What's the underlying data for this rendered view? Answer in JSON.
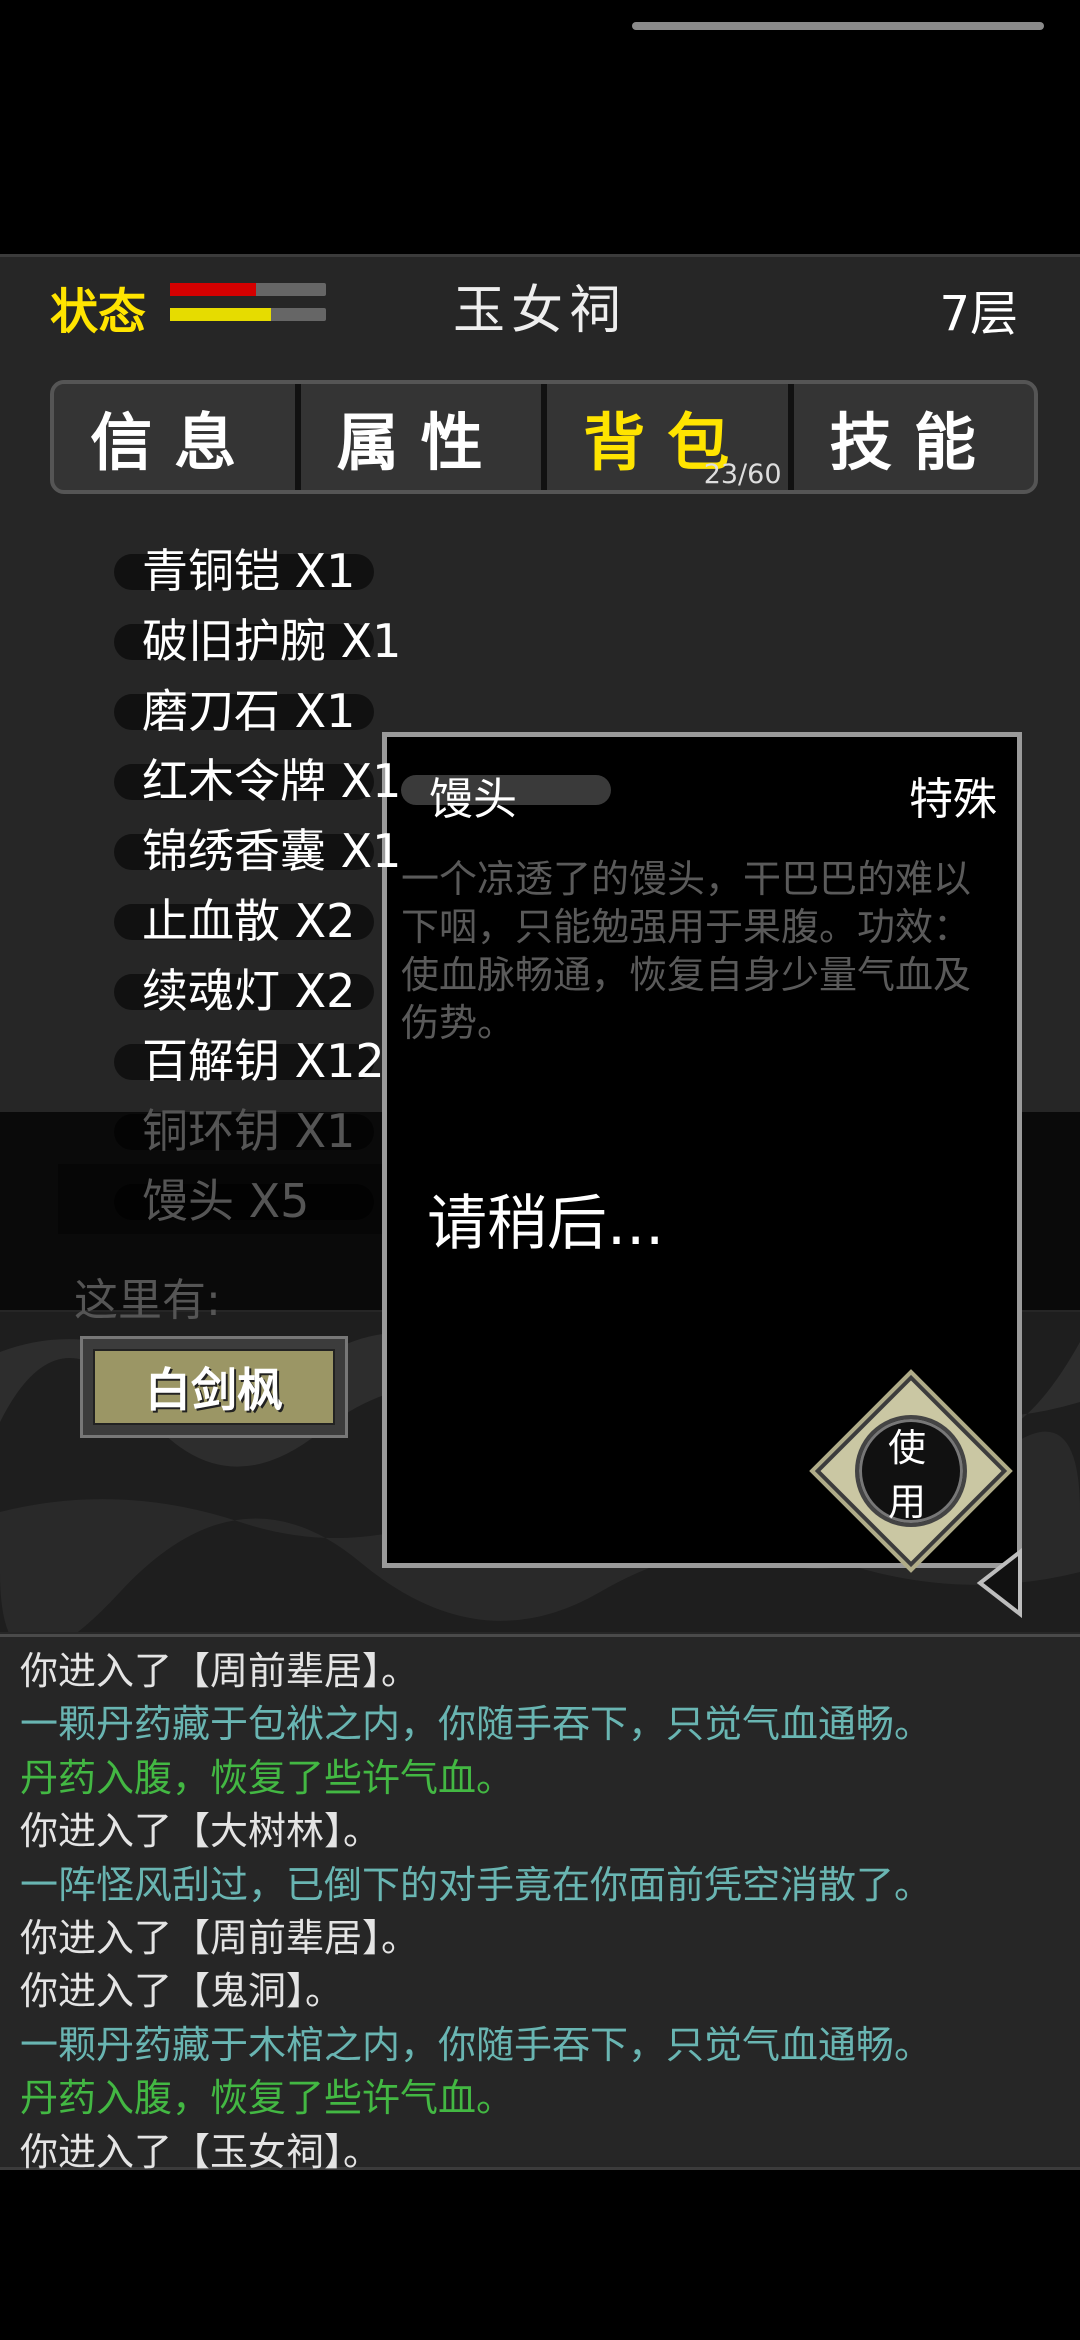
{
  "header": {
    "status_label": "状态",
    "hp_fraction": 0.55,
    "mp_fraction": 0.65,
    "location": "玉女祠",
    "floor": "7层"
  },
  "tabs": [
    {
      "label": "信息",
      "active": false
    },
    {
      "label": "属性",
      "active": false
    },
    {
      "label": "背包",
      "active": true,
      "count": "23/60"
    },
    {
      "label": "技能",
      "active": false
    }
  ],
  "inventory": [
    "青铜铠 X1",
    "破旧护腕 X1",
    "磨刀石 X1",
    "红木令牌 X1",
    "锦绣香囊 X1",
    "止血散 X2",
    "续魂灯 X2",
    "百解钥 X12",
    "铜环钥 X1",
    "馒头 X5"
  ],
  "here": {
    "label": "这里有:",
    "npc": "白剑枫"
  },
  "popup": {
    "name": "馒头",
    "type": "特殊",
    "description": "一个凉透了的馒头，干巴巴的难以下咽，只能勉强用于果腹。功效：使血脉畅通，恢复自身少量气血及伤势。",
    "wait_text": "请稍后...",
    "use_line1": "使",
    "use_line2": "用"
  },
  "log": [
    {
      "text": "你进入了【周前辈居】。",
      "color": "white"
    },
    {
      "text": "一颗丹药藏于包袱之内，你随手吞下，只觉气血通畅。",
      "color": "teal"
    },
    {
      "text": "丹药入腹，恢复了些许气血。",
      "color": "green"
    },
    {
      "text": "你进入了【大树林】。",
      "color": "white"
    },
    {
      "text": "一阵怪风刮过，已倒下的对手竟在你面前凭空消散了。",
      "color": "teal"
    },
    {
      "text": "你进入了【周前辈居】。",
      "color": "white"
    },
    {
      "text": "你进入了【鬼洞】。",
      "color": "white"
    },
    {
      "text": "一颗丹药藏于木棺之内，你随手吞下，只觉气血通畅。",
      "color": "teal"
    },
    {
      "text": "丹药入腹，恢复了些许气血。",
      "color": "green"
    },
    {
      "text": "你进入了【玉女祠】。",
      "color": "white"
    }
  ]
}
